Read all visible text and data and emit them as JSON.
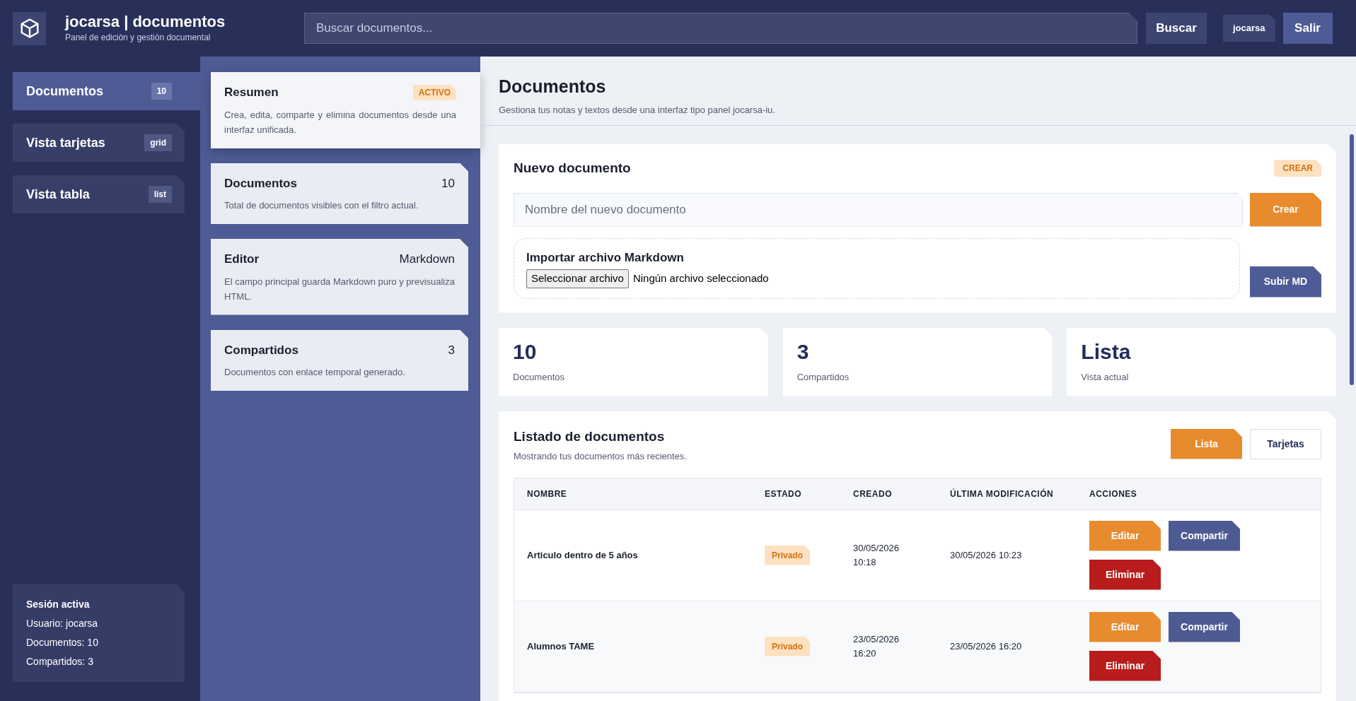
{
  "header": {
    "title": "jocarsa | documentos",
    "subtitle": "Panel de edición y gestión documental",
    "search": {
      "placeholder": "Buscar documentos..."
    },
    "search_button": "Buscar",
    "user": "jocarsa",
    "logout": "Salir"
  },
  "sidebar": {
    "items": [
      {
        "label": "Documentos",
        "badge": "10",
        "selected": true
      },
      {
        "label": "Vista tarjetas",
        "badge": "grid",
        "selected": false
      },
      {
        "label": "Vista tabla",
        "badge": "list",
        "selected": false
      }
    ],
    "session": {
      "title": "Sesión activa",
      "lines": [
        "Usuario: jocarsa",
        "Documentos: 10",
        "Compartidos: 3"
      ]
    }
  },
  "summary_cards": [
    {
      "title": "Resumen",
      "badge": "ACTIVO",
      "text": "Crea, edita, comparte y elimina documentos desde una interfaz unificada.",
      "selected": true
    },
    {
      "title": "Documentos",
      "value": "10",
      "text": "Total de documentos visibles con el filtro actual.",
      "selected": false
    },
    {
      "title": "Editor",
      "value": "Markdown",
      "text": "El campo principal guarda Markdown puro y previsualiza HTML.",
      "selected": false
    },
    {
      "title": "Compartidos",
      "value": "3",
      "text": "Documentos con enlace temporal generado.",
      "selected": false
    }
  ],
  "main": {
    "title": "Documentos",
    "subtitle": "Gestiona tus notas y textos desde una interfaz tipo panel jocarsa-iu."
  },
  "new_document": {
    "title": "Nuevo documento",
    "badge": "CREAR",
    "name_field": {
      "placeholder": "Nombre del nuevo documento"
    },
    "create_button": "Crear",
    "import": {
      "title": "Importar archivo Markdown",
      "file_button": "Seleccionar archivo",
      "file_status": "Ningún archivo seleccionado"
    },
    "upload_button": "Subir MD"
  },
  "stats": [
    {
      "value": "10",
      "label": "Documentos"
    },
    {
      "value": "3",
      "label": "Compartidos"
    },
    {
      "value": "Lista",
      "label": "Vista actual"
    }
  ],
  "listing": {
    "title": "Listado de documentos",
    "subtitle": "Mostrando tus documentos más recientes.",
    "views": [
      {
        "label": "Lista",
        "selected": true
      },
      {
        "label": "Tarjetas",
        "selected": false
      }
    ],
    "table": {
      "columns": [
        "NOMBRE",
        "ESTADO",
        "CREADO",
        "ÚLTIMA MODIFICACIÓN",
        "ACCIONES"
      ],
      "rows": [
        {
          "name": "Articulo dentro de 5 años",
          "status": "Privado",
          "created": "30/05/2026 10:18",
          "modified": "30/05/2026 10:23",
          "actions": [
            {
              "label": "Editar",
              "kind": "edit"
            },
            {
              "label": "Compartir",
              "kind": "share"
            },
            {
              "label": "Eliminar",
              "kind": "delete"
            }
          ]
        },
        {
          "name": "Alumnos TAME",
          "status": "Privado",
          "created": "23/05/2026 16:20",
          "modified": "23/05/2026 16:20",
          "actions": [
            {
              "label": "Editar",
              "kind": "edit"
            },
            {
              "label": "Compartir",
              "kind": "share"
            },
            {
              "label": "Eliminar",
              "kind": "delete"
            }
          ]
        }
      ]
    }
  }
}
